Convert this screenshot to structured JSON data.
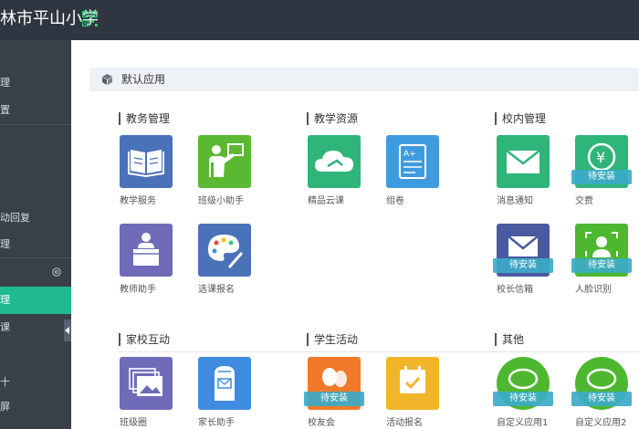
{
  "header": {
    "school_name": "林市平山小学",
    "qr_icon": "qr-code-icon"
  },
  "sidebar": {
    "items": [
      {
        "label": ""
      },
      {
        "label": "理"
      },
      {
        "label": "置"
      },
      {
        "label": ""
      },
      {
        "label": ""
      },
      {
        "label": ""
      },
      {
        "label": "动回复"
      },
      {
        "label": "理"
      },
      {
        "label": ""
      },
      {
        "label": "理"
      },
      {
        "label": "课"
      },
      {
        "label": ""
      },
      {
        "label": "十"
      },
      {
        "label": "屏"
      }
    ],
    "active_color": "#1fb992"
  },
  "section": {
    "title": "默认应用",
    "icon": "cube-icon"
  },
  "groups": [
    {
      "title": "教务管理"
    },
    {
      "title": "教学资源"
    },
    {
      "title": "校内管理"
    },
    {
      "title": "家校互动"
    },
    {
      "title": "学生活动"
    },
    {
      "title": "其他"
    }
  ],
  "apps": [
    {
      "label": "教学服务",
      "icon": "book-icon",
      "badge": ""
    },
    {
      "label": "班级小助手",
      "icon": "teacher-board-icon",
      "badge": ""
    },
    {
      "label": "教师助手",
      "icon": "podium-icon",
      "badge": ""
    },
    {
      "label": "选课报名",
      "icon": "palette-icon",
      "badge": ""
    },
    {
      "label": "精品云课",
      "icon": "cloud-icon",
      "badge": ""
    },
    {
      "label": "组卷",
      "icon": "exam-paper-icon",
      "badge": ""
    },
    {
      "label": "消息通知",
      "icon": "envelope-icon",
      "badge": ""
    },
    {
      "label": "交费",
      "icon": "yen-coin-icon",
      "badge": "待安装"
    },
    {
      "label": "校长信箱",
      "icon": "mailbox-icon",
      "badge": "待安装"
    },
    {
      "label": "人脸识别",
      "icon": "face-scan-icon",
      "badge": "待安装"
    },
    {
      "label": "班级圈",
      "icon": "photos-icon",
      "badge": ""
    },
    {
      "label": "家长助手",
      "icon": "parent-mailbox-icon",
      "badge": ""
    },
    {
      "label": "校友会",
      "icon": "people-icon",
      "badge": "待安装"
    },
    {
      "label": "活动报名",
      "icon": "calendar-check-icon",
      "badge": ""
    },
    {
      "label": "自定义应用1",
      "icon": "chat-bubble-icon",
      "badge": "待安装"
    },
    {
      "label": "自定义应用2",
      "icon": "chat-bubble-icon",
      "badge": "待安装"
    }
  ],
  "colors": {
    "topbar": "#2f3641",
    "sidebar": "#3a404a",
    "badge": "#3caac8",
    "blue_tile": "#4a72b8",
    "green_tile": "#5bb832",
    "purple_tile": "#6f6bb8",
    "teal_tile": "#2fb57a",
    "sky_tile": "#3f9be0",
    "orange_tile": "#f07a2a",
    "yellow_tile": "#f2b52a"
  }
}
